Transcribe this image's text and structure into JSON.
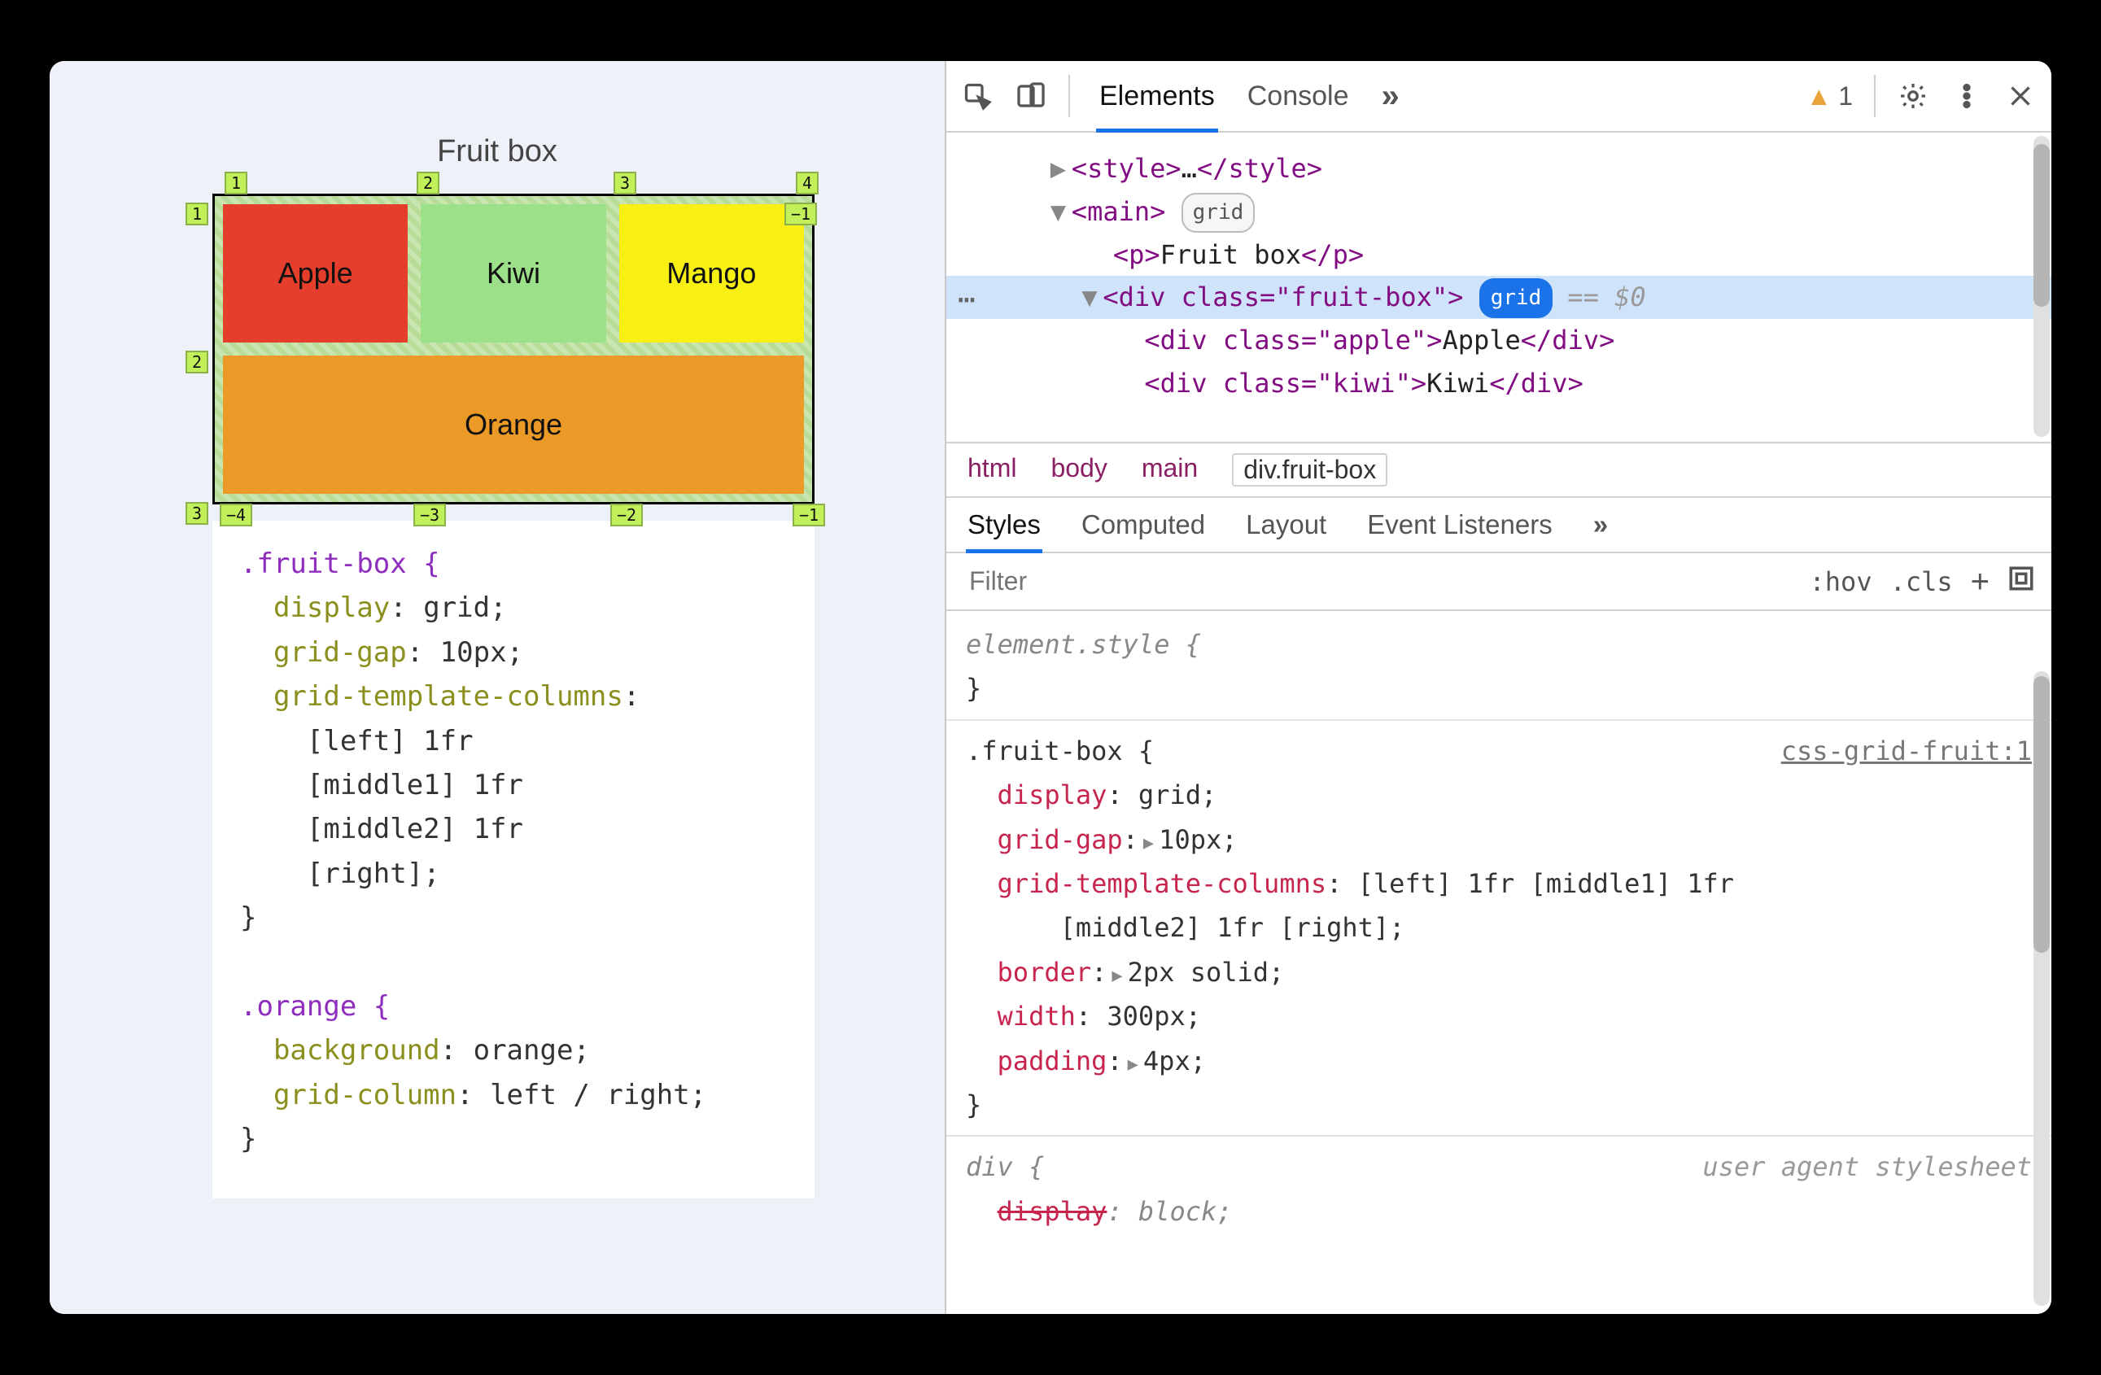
{
  "page": {
    "title": "Fruit box",
    "cells": {
      "apple": "Apple",
      "kiwi": "Kiwi",
      "mango": "Mango",
      "orange": "Orange"
    },
    "gridnums": {
      "colsTop": [
        "1",
        "2",
        "3",
        "4"
      ],
      "rowsLeft": [
        "1",
        "2",
        "3"
      ],
      "rightNeg": "−1",
      "colsBottom": [
        "−4",
        "−3",
        "−2",
        "−1"
      ]
    }
  },
  "css_snippet": {
    "rule1_selector": ".fruit-box {",
    "rule1_lines": [
      "display: grid;",
      "grid-gap: 10px;",
      "grid-template-columns:",
      "  [left] 1fr",
      "  [middle1] 1fr",
      "  [middle2] 1fr",
      "  [right];"
    ],
    "brace_close": "}",
    "rule2_selector": ".orange {",
    "rule2_lines": [
      "background: orange;",
      "grid-column: left / right;"
    ]
  },
  "toolbar": {
    "tabs": [
      "Elements",
      "Console"
    ],
    "overflow": "»",
    "warn_count": "1"
  },
  "dom": {
    "line1": {
      "pre": "▶",
      "open": "<style>",
      "mid": "…",
      "close": "</style>"
    },
    "line2": {
      "pre": "▼",
      "open": "<main>",
      "badge": "grid"
    },
    "line3": {
      "open": "<p>",
      "text": "Fruit box",
      "close": "</p>"
    },
    "line4": {
      "pre": "▼",
      "open": "<div class=\"fruit-box\">",
      "badge": "grid",
      "dollar": "== $0"
    },
    "line5": {
      "open": "<div class=\"apple\">",
      "text": "Apple",
      "close": "</div>"
    },
    "line6": {
      "open": "<div class=\"kiwi\">",
      "text": "Kiwi",
      "close": "</div>"
    }
  },
  "breadcrumbs": [
    "html",
    "body",
    "main",
    "div.fruit-box"
  ],
  "styles_tabs": [
    "Styles",
    "Computed",
    "Layout",
    "Event Listeners"
  ],
  "styles_overflow": "»",
  "filter": {
    "placeholder": "Filter",
    "hov": ":hov",
    "cls": ".cls"
  },
  "rules": {
    "element_style": "element.style {",
    "brace_close": "}",
    "fruitbox_sel": ".fruit-box {",
    "fruitbox_src": "css-grid-fruit:1",
    "fb": {
      "p1": "display",
      "v1": "grid;",
      "p2": "grid-gap",
      "v2": "10px;",
      "p3": "grid-template-columns",
      "v3a": "[left] 1fr [middle1] 1fr",
      "v3b": "[middle2] 1fr [right];",
      "p4": "border",
      "v4": "2px solid;",
      "p5": "width",
      "v5": "300px;",
      "p6": "padding",
      "v6": "4px;"
    },
    "div_sel": "div {",
    "div_src": "user agent stylesheet",
    "div_p1": "display",
    "div_v1": "block;",
    "triangle": "▶"
  }
}
